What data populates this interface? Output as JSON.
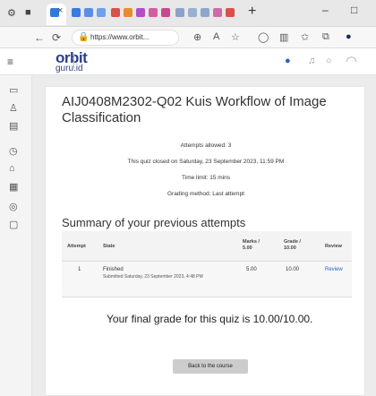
{
  "browser": {
    "tab_close": "×",
    "new_tab": "+",
    "window_min": "–",
    "window_max": "□",
    "url": "https://www.orbit...",
    "url_lock": "🔒"
  },
  "site": {
    "logo_top": "orbit",
    "logo_bottom": "guru.id"
  },
  "quiz": {
    "title": "AIJ0408M2302-Q02 Kuis Workflow of Image Classification",
    "attempts_allowed": "Attempts allowed: 3",
    "closed": "This quiz closed on Saturday, 23 September 2023, 11:59 PM",
    "time_limit": "Time limit: 15 mins",
    "grading_method": "Grading method: Last attempt"
  },
  "summary": {
    "heading": "Summary of your previous attempts",
    "columns": {
      "attempt": "Attempt",
      "state": "State",
      "marks": "Marks / 5.00",
      "grade": "Grade / 10.00",
      "review": "Review"
    },
    "rows": [
      {
        "attempt": "1",
        "state": "Finished",
        "submitted": "Submitted Saturday, 23 September 2023, 4:48 PM",
        "marks": "5.00",
        "grade": "10.00",
        "review": "Review"
      }
    ]
  },
  "final_grade": "Your final grade for this quiz is 10.00/10.00.",
  "back_button": "Back to the course",
  "colors": {
    "brand": "#2c3e8c",
    "link": "#2c62b8"
  }
}
